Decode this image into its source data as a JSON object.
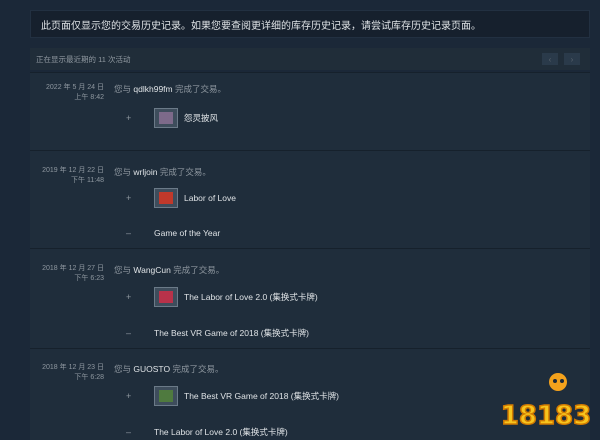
{
  "notice": "此页面仅显示您的交易历史记录。如果您要查阅更详细的库存历史记录，请尝试库存历史记录页面。",
  "summary": "正在显示最近期的 11 次活动",
  "pager": {
    "prev": "‹",
    "next": "›"
  },
  "you_with": "您与",
  "completed": "完成了交易。",
  "entries": [
    {
      "date": "2022 年 5 月 24 日",
      "time": "上午 8:42",
      "user": "qdlkh99fm",
      "items": [
        {
          "sign": "+",
          "name": "怨灵披风",
          "has_icon": true,
          "icon_color": "#7d6a8a"
        }
      ]
    },
    {
      "date": "2019 年 12 月 22 日",
      "time": "下午 11:48",
      "user": "wrljoin",
      "items": [
        {
          "sign": "+",
          "name": "Labor of Love",
          "has_icon": true,
          "icon_color": "#c0392b"
        },
        {
          "sign": "–",
          "name": "Game of the Year",
          "has_icon": false
        }
      ]
    },
    {
      "date": "2018 年 12 月 27 日",
      "time": "下午 6:23",
      "user": "WangCun",
      "items": [
        {
          "sign": "+",
          "name": "The Labor of Love 2.0 (集换式卡牌)",
          "has_icon": true,
          "icon_color": "#b8324a"
        },
        {
          "sign": "–",
          "name": "The Best VR Game of 2018 (集换式卡牌)",
          "has_icon": false
        }
      ]
    },
    {
      "date": "2018 年 12 月 23 日",
      "time": "下午 6:28",
      "user": "GUOSTO",
      "items": [
        {
          "sign": "+",
          "name": "The Best VR Game of 2018 (集换式卡牌)",
          "has_icon": true,
          "icon_color": "#4f7a3f"
        },
        {
          "sign": "–",
          "name": "The Labor of Love 2.0 (集换式卡牌)",
          "has_icon": false
        }
      ]
    }
  ],
  "watermark": "18183"
}
